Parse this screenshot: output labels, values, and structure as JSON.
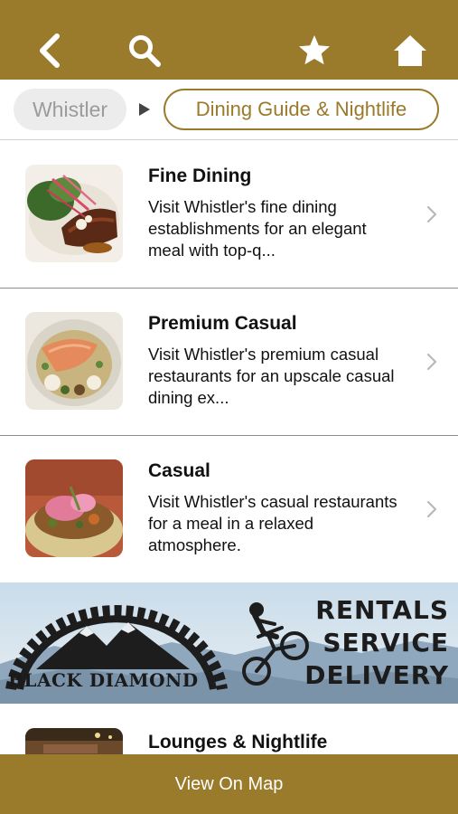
{
  "toolbar": {
    "back_icon": "chevron-left-icon",
    "search_icon": "search-icon",
    "favorite_icon": "star-icon",
    "home_icon": "home-icon",
    "accent_color": "#9a7a2b"
  },
  "breadcrumb": {
    "root": "Whistler",
    "current": "Dining Guide & Nightlife"
  },
  "categories": [
    {
      "title": "Fine Dining",
      "description": "Visit Whistler's fine dining establishments for an elegant meal with top-q..."
    },
    {
      "title": "Premium Casual",
      "description": "Visit Whistler's premium casual restaurants for an upscale casual dining ex..."
    },
    {
      "title": "Casual",
      "description": "Visit Whistler's casual restaurants for a meal in a relaxed atmosphere."
    },
    {
      "title": "Lounges & Nightlife",
      "description": ""
    }
  ],
  "ad": {
    "brand": "BLACK DIAMOND",
    "lines": [
      "RENTALS",
      "SERVICE",
      "DELIVERY"
    ]
  },
  "footer": {
    "map_label": "View On Map"
  }
}
